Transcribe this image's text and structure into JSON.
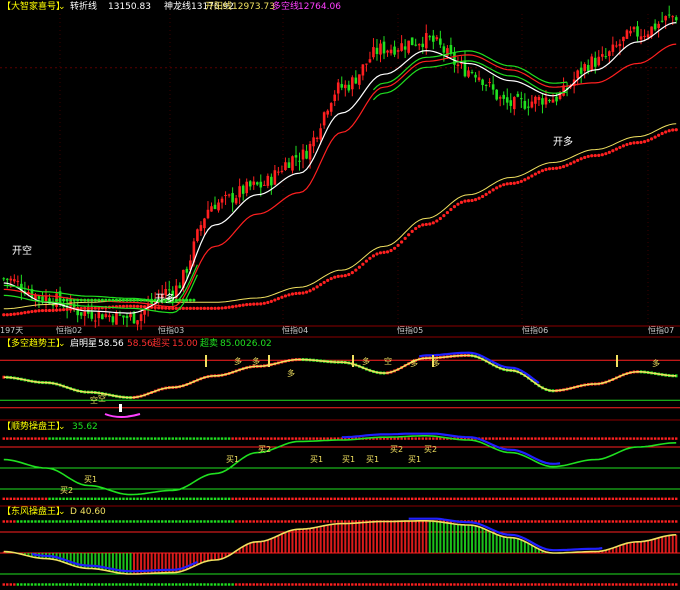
{
  "panels": [
    {
      "id": "main",
      "title": "【大智家喜号】",
      "legend": [
        {
          "label": "转折线",
          "value": "13150.83",
          "color": "#ffffff"
        },
        {
          "label": "神龙线",
          "value": "13176.92",
          "color": "#ffffff"
        },
        {
          "label": "开阳线",
          "value": "12973.73",
          "color": "#f0e060"
        },
        {
          "label": "多空线",
          "value": "12764.06",
          "color": "#ff40ff"
        }
      ],
      "annotations": [
        "开空",
        "开多",
        "开多"
      ]
    },
    {
      "id": "trend",
      "title": "【多空趋势王】",
      "legend": [
        {
          "label": "启明星",
          "value": "58.56",
          "color": "#ffffff"
        },
        {
          "label": "",
          "value": "58.56",
          "color": "#ff3030"
        },
        {
          "label": "超买",
          "value": "15.00",
          "color": "#ff3030"
        },
        {
          "label": "超卖",
          "value": "85.00",
          "color": "#20e020"
        },
        {
          "label": "",
          "value": "26.02",
          "color": "#20e020"
        }
      ],
      "annotations": [
        "空",
        "空",
        "多",
        "多",
        "多",
        "多",
        "空",
        "多",
        "多",
        "多"
      ]
    },
    {
      "id": "momentum",
      "title": "【顺势操盘王】",
      "legend": [
        {
          "label": "",
          "value": "35.62",
          "color": "#20e020"
        }
      ],
      "annotations": [
        "买1",
        "买2",
        "买1",
        "买2",
        "买1",
        "买1",
        "买1",
        "买2",
        "买1",
        "买2"
      ]
    },
    {
      "id": "wind",
      "title": "【东风操盘王】",
      "legend": [
        {
          "label": "D",
          "value": "40.60",
          "color": "#f0e060"
        }
      ],
      "annotations": []
    }
  ],
  "xaxis": {
    "left_label": "197天",
    "ticks": [
      "恒指02",
      "恒指03",
      "恒指04",
      "恒指05",
      "恒指06",
      "恒指07"
    ]
  },
  "chart_data": [
    {
      "type": "line",
      "title": "【大智家喜号】",
      "ylim": [
        11950,
        13400
      ],
      "x": [
        0,
        12,
        24,
        36,
        48,
        60,
        72,
        84,
        96,
        108,
        120,
        132,
        144,
        156,
        168,
        180,
        191
      ],
      "series": [
        {
          "name": "转折线",
          "values": [
            12150,
            12060,
            12020,
            12010,
            12080,
            12420,
            12560,
            12660,
            12940,
            13120,
            13230,
            13170,
            13090,
            13020,
            13140,
            13270,
            13360
          ]
        },
        {
          "name": "开阳线",
          "values": [
            12120,
            12090,
            12070,
            12060,
            12040,
            12320,
            12470,
            12570,
            12850,
            13060,
            13180,
            13210,
            13140,
            13060,
            13080,
            13170,
            13260
          ]
        },
        {
          "name": "多空线",
          "values": [
            12030,
            12050,
            12060,
            12070,
            12060,
            12060,
            12080,
            12130,
            12210,
            12320,
            12450,
            12560,
            12640,
            12710,
            12770,
            12830,
            12890
          ]
        }
      ],
      "close": [
        12170,
        12080,
        12010,
        11990,
        12120,
        12520,
        12600,
        12740,
        13060,
        13240,
        13280,
        13140,
        12980,
        13010,
        13180,
        13310,
        13390
      ]
    },
    {
      "type": "line",
      "title": "【多空趋势王】",
      "ylim": [
        0,
        100
      ],
      "hlines": [
        15,
        26.02,
        85
      ],
      "x": [
        0,
        12,
        24,
        36,
        48,
        60,
        72,
        84,
        96,
        108,
        120,
        132,
        144,
        156,
        168,
        180,
        191
      ],
      "series": [
        {
          "name": "启明星",
          "values": [
            60,
            52,
            38,
            30,
            45,
            62,
            76,
            86,
            82,
            66,
            88,
            92,
            70,
            40,
            50,
            68,
            62
          ]
        }
      ]
    },
    {
      "type": "line",
      "title": "【顺势操盘王】",
      "ylim": [
        0,
        100
      ],
      "hlines": [
        20,
        50,
        80
      ],
      "x": [
        0,
        12,
        24,
        36,
        48,
        60,
        72,
        84,
        96,
        108,
        120,
        132,
        144,
        156,
        168,
        180,
        191
      ],
      "series": [
        {
          "name": "",
          "values": [
            62,
            50,
            25,
            12,
            18,
            42,
            72,
            88,
            90,
            94,
            96,
            90,
            72,
            52,
            62,
            80,
            86
          ]
        }
      ]
    },
    {
      "type": "line",
      "title": "【东风操盘王】",
      "ylim": [
        0,
        100
      ],
      "hlines": [
        20,
        50,
        80
      ],
      "x": [
        0,
        12,
        24,
        36,
        48,
        60,
        72,
        84,
        96,
        108,
        120,
        132,
        144,
        156,
        168,
        180,
        191
      ],
      "series": [
        {
          "name": "D",
          "values": [
            52,
            42,
            28,
            20,
            22,
            40,
            66,
            84,
            92,
            95,
            96,
            90,
            72,
            50,
            52,
            66,
            76
          ]
        }
      ]
    }
  ],
  "colors": {
    "up": "#ff2020",
    "down": "#20e020",
    "white": "#ffffff",
    "green": "#20e020",
    "red": "#ff2020",
    "yellow": "#f0e060",
    "blue": "#2020ff",
    "magenta": "#ff40ff",
    "frame": "#8b0000",
    "grid": "#5a0000"
  }
}
